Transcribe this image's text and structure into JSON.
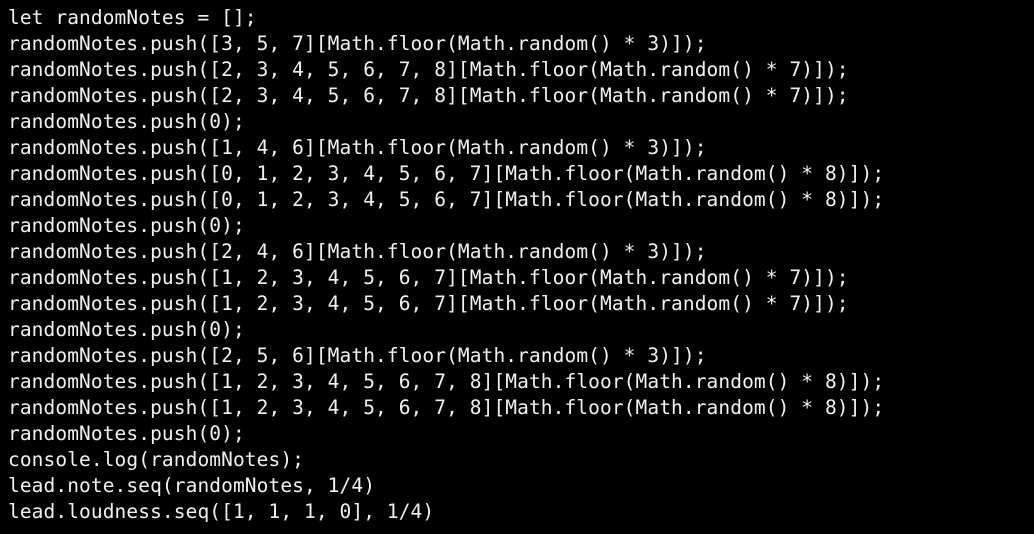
{
  "editor": {
    "lines": [
      "let randomNotes = [];",
      "randomNotes.push([3, 5, 7][Math.floor(Math.random() * 3)]);",
      "randomNotes.push([2, 3, 4, 5, 6, 7, 8][Math.floor(Math.random() * 7)]);",
      "randomNotes.push([2, 3, 4, 5, 6, 7, 8][Math.floor(Math.random() * 7)]);",
      "randomNotes.push(0);",
      "randomNotes.push([1, 4, 6][Math.floor(Math.random() * 3)]);",
      "randomNotes.push([0, 1, 2, 3, 4, 5, 6, 7][Math.floor(Math.random() * 8)]);",
      "randomNotes.push([0, 1, 2, 3, 4, 5, 6, 7][Math.floor(Math.random() * 8)]);",
      "randomNotes.push(0);",
      "randomNotes.push([2, 4, 6][Math.floor(Math.random() * 3)]);",
      "randomNotes.push([1, 2, 3, 4, 5, 6, 7][Math.floor(Math.random() * 7)]);",
      "randomNotes.push([1, 2, 3, 4, 5, 6, 7][Math.floor(Math.random() * 7)]);",
      "randomNotes.push(0);",
      "randomNotes.push([2, 5, 6][Math.floor(Math.random() * 3)]);",
      "randomNotes.push([1, 2, 3, 4, 5, 6, 7, 8][Math.floor(Math.random() * 8)]);",
      "randomNotes.push([1, 2, 3, 4, 5, 6, 7, 8][Math.floor(Math.random() * 8)]);",
      "randomNotes.push(0);",
      "console.log(randomNotes);",
      "lead.note.seq(randomNotes, 1/4)",
      "lead.loudness.seq([1, 1, 1, 0], 1/4)"
    ]
  }
}
